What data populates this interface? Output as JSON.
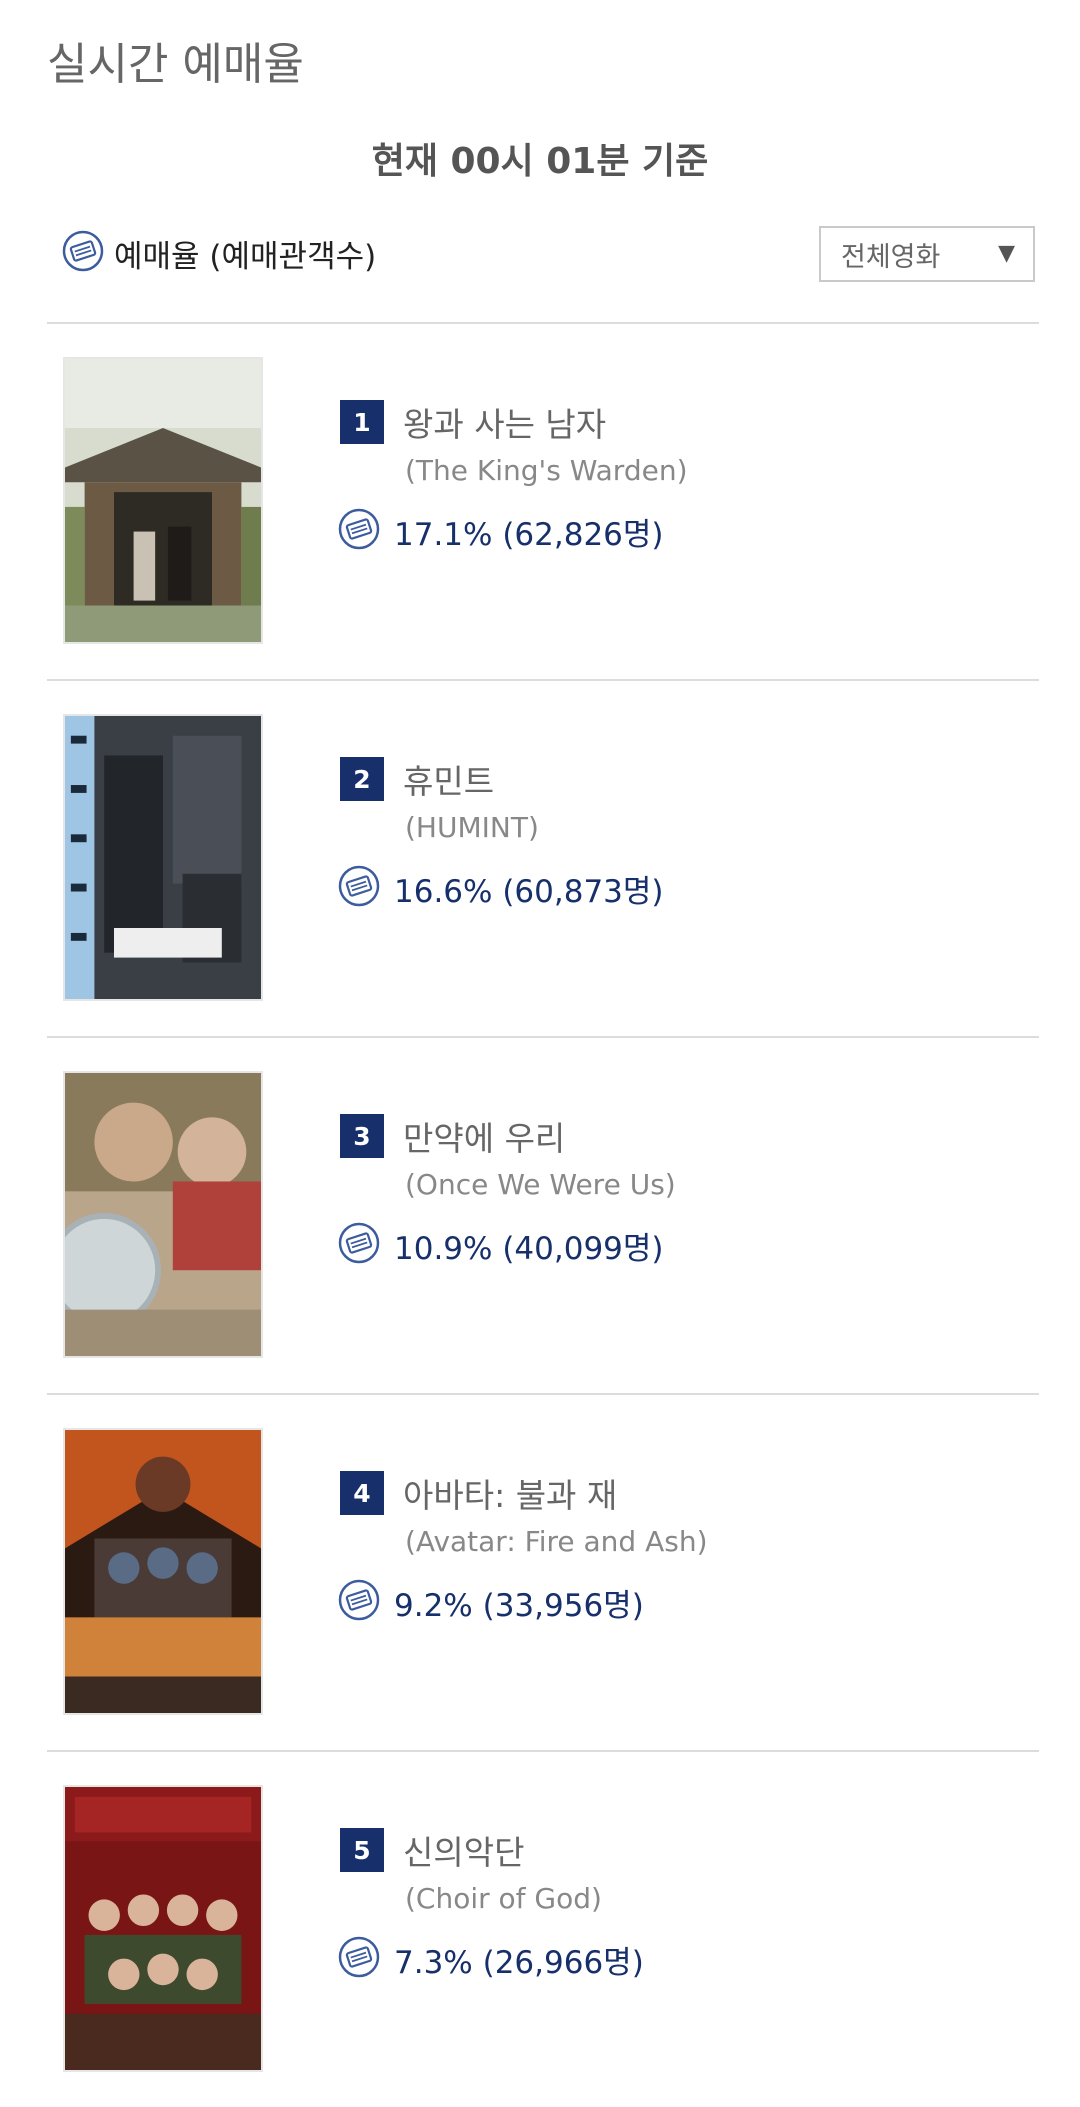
{
  "header": {
    "title": "실시간 예매율",
    "time_label": "현재  00시 01분   기준"
  },
  "filter": {
    "legend_label": "예매율 (예매관객수)",
    "select_value": "전체영화",
    "arrow": "▼"
  },
  "colors": {
    "accent_navy": "#17306b",
    "ticket_icon": "#3c5c9e"
  },
  "movies": [
    {
      "rank": "1",
      "title_ko": "왕과 사는 남자",
      "title_en": "(The King's Warden)",
      "rate": "17.1% (62,826명)"
    },
    {
      "rank": "2",
      "title_ko": "휴민트",
      "title_en": "(HUMINT)",
      "rate": "16.6% (60,873명)"
    },
    {
      "rank": "3",
      "title_ko": "만약에 우리",
      "title_en": "(Once We Were Us)",
      "rate": "10.9% (40,099명)"
    },
    {
      "rank": "4",
      "title_ko": "아바타: 불과 재",
      "title_en": "(Avatar: Fire and Ash)",
      "rate": "9.2% (33,956명)"
    },
    {
      "rank": "5",
      "title_ko": "신의악단",
      "title_en": "(Choir of God)",
      "rate": "7.3% (26,966명)"
    }
  ]
}
